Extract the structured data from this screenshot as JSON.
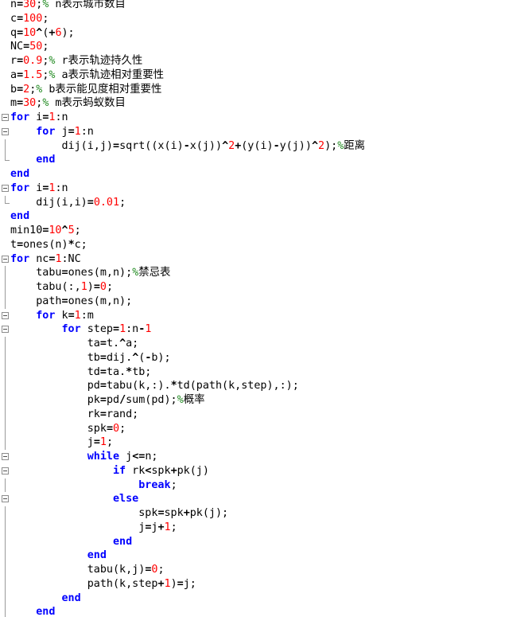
{
  "editor": {
    "lines": [
      "n=30;% n表示城市数目",
      "c=100;",
      "q=10^(+6);",
      "NC=50;",
      "r=0.9;% r表示轨迹持久性",
      "a=1.5;% a表示轨迹相对重要性",
      "b=2;% b表示能见度相对重要性",
      "m=30;% m表示蚂蚁数目",
      "for i=1:n",
      "    for j=1:n",
      "        dij(i,j)=sqrt((x(i)-x(j))^2+(y(i)-y(j))^2);%距离",
      "    end",
      "end",
      "for i=1:n",
      "    dij(i,i)=0.01;",
      "end",
      "min10=10^5;",
      "t=ones(n)*c;",
      "for nc=1:NC",
      "    tabu=ones(m,n);%禁忌表",
      "    tabu(:,1)=0;",
      "    path=ones(m,n);",
      "    for k=1:m",
      "        for step=1:n-1",
      "            ta=t.^a;",
      "            tb=dij.^(-b);",
      "            td=ta.*tb;",
      "            pd=tabu(k,:).*td(path(k,step),:);",
      "            pk=pd/sum(pd);%概率",
      "            rk=rand;",
      "            spk=0;",
      "            j=1;",
      "            while j<=n;",
      "                if rk<spk+pk(j)",
      "                    break;",
      "                else",
      "                    spk=spk+pk(j);",
      "                    j=j+1;",
      "                end",
      "            end",
      "            tabu(k,j)=0;",
      "            path(k,step+1)=j;",
      "        end",
      "    end"
    ]
  }
}
